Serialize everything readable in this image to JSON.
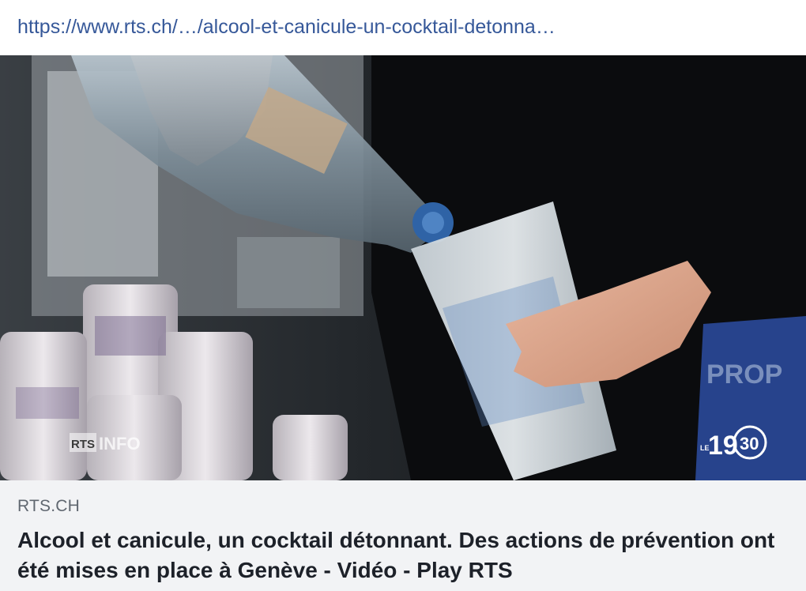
{
  "link_preview": {
    "url": "https://www.rts.ch/…/alcool-et-canicule-un-cocktail-detonna…",
    "image": {
      "alt_description": "Hand pouring water from a plastic bottle into a frosted plastic cup next to stacked cups",
      "watermark_left": {
        "badge": "RTS",
        "text": "INFO"
      },
      "watermark_right": {
        "prefix": "LE",
        "number": "19",
        "circle": "30"
      }
    },
    "domain": "RTS.CH",
    "title": "Alcool et canicule, un cocktail détonnant. Des actions de prévention ont été mises en place à Genève - Vidéo - Play RTS"
  },
  "colors": {
    "link": "#365899",
    "caption_bg": "#f2f3f5",
    "domain_text": "#606770",
    "title_text": "#1d2129"
  }
}
